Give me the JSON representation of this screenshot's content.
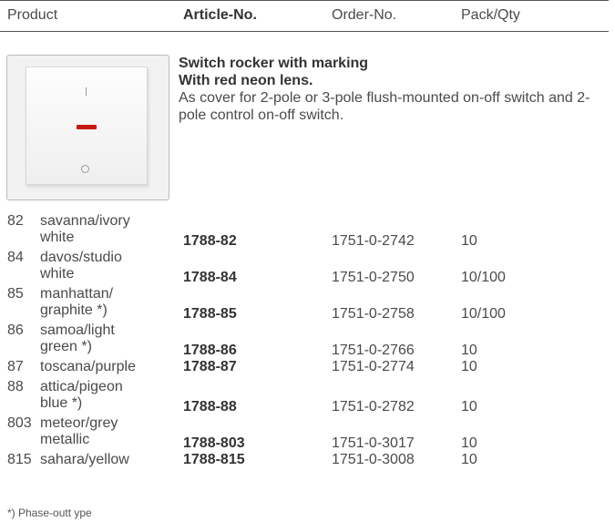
{
  "header": {
    "product": "Product",
    "article": "Article-No.",
    "order": "Order-No.",
    "pack": "Pack/Qty"
  },
  "description": {
    "title1": "Switch rocker with marking",
    "title2": "With red neon lens.",
    "text": "As cover for 2-pole or 3-pole flush-mounted on-off switch and 2-pole control on-off switch."
  },
  "rows": [
    {
      "num": "82",
      "name_line1": "savanna/ivory",
      "name_line2": "white",
      "article": "1788-82",
      "order": "1751-0-2742",
      "pack": "10"
    },
    {
      "num": "84",
      "name_line1": "davos/studio",
      "name_line2": "white",
      "article": "1788-84",
      "order": "1751-0-2750",
      "pack": "10/100"
    },
    {
      "num": "85",
      "name_line1": "manhattan/",
      "name_line2": "graphite *)",
      "article": "1788-85",
      "order": "1751-0-2758",
      "pack": "10/100"
    },
    {
      "num": "86",
      "name_line1": "samoa/light",
      "name_line2": "green *)",
      "article": "1788-86",
      "order": "1751-0-2766",
      "pack": "10"
    },
    {
      "num": "87",
      "name_line1": "toscana/purple",
      "name_line2": "",
      "article": "1788-87",
      "order": "1751-0-2774",
      "pack": "10"
    },
    {
      "num": "88",
      "name_line1": "attica/pigeon",
      "name_line2": "blue *)",
      "article": "1788-88",
      "order": "1751-0-2782",
      "pack": "10"
    },
    {
      "num": "803",
      "name_line1": "meteor/grey",
      "name_line2": "metallic",
      "article": "1788-803",
      "order": "1751-0-3017",
      "pack": "10"
    },
    {
      "num": "815",
      "name_line1": "sahara/yellow",
      "name_line2": "",
      "article": "1788-815",
      "order": "1751-0-3008",
      "pack": "10"
    }
  ],
  "footnote": "*)  Phase-outt ype",
  "colors": {
    "lens": "#c61a10",
    "text": "#4a4a4a"
  }
}
